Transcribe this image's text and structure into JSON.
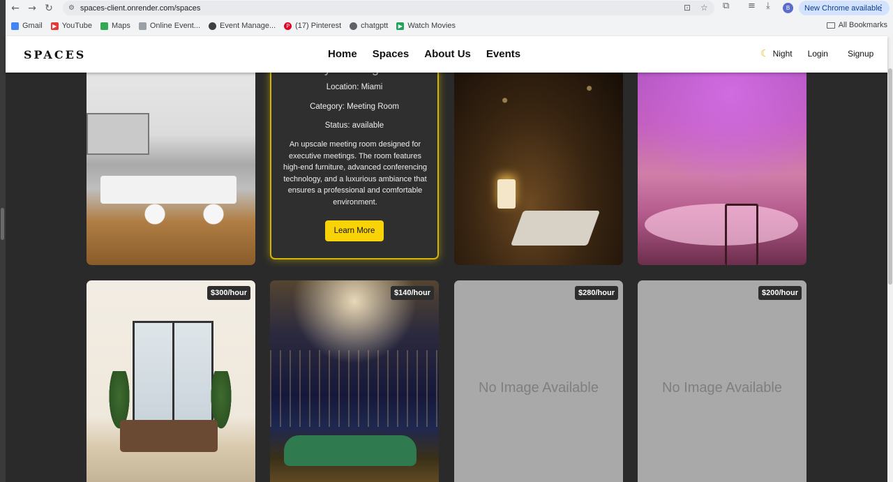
{
  "browser": {
    "url": "spaces-client.onrender.com/spaces",
    "profile_initial": "B",
    "update_label": "New Chrome available",
    "bookmarks": [
      {
        "label": "Gmail",
        "color": "#4285f4"
      },
      {
        "label": "YouTube",
        "color": "#e53935"
      },
      {
        "label": "Maps",
        "color": "#34a853"
      },
      {
        "label": "Online Event...",
        "color": "#9aa0a6"
      },
      {
        "label": "Event Manage...",
        "color": "#3c4043"
      },
      {
        "label": "(17) Pinterest",
        "color": "#e60023"
      },
      {
        "label": "chatgptt",
        "color": "#5f6368"
      },
      {
        "label": "Watch Movies",
        "color": "#22a35a"
      }
    ],
    "all_bookmarks": "All Bookmarks"
  },
  "site": {
    "logo": "SPACES",
    "nav": [
      "Home",
      "Spaces",
      "About Us",
      "Events"
    ],
    "night_label": "Night",
    "login_label": "Login",
    "signup_label": "Signup",
    "accent": "#f7d308"
  },
  "spaces": {
    "featured": {
      "title": "Luxury Meeting Room",
      "location": "Location: Miami",
      "category": "Category: Meeting Room",
      "status": "Status: available",
      "description": "An upscale meeting room designed for executive meetings. The room features high-end furniture, advanced conferencing technology, and a luxurious ambiance that ensures a professional and comfortable environment.",
      "cta": "Learn More"
    },
    "row2": [
      {
        "price": "$300/hour"
      },
      {
        "price": "$140/hour"
      },
      {
        "price": "$280/hour",
        "placeholder": "No Image Available"
      },
      {
        "price": "$200/hour",
        "placeholder": "No Image Available"
      }
    ]
  }
}
